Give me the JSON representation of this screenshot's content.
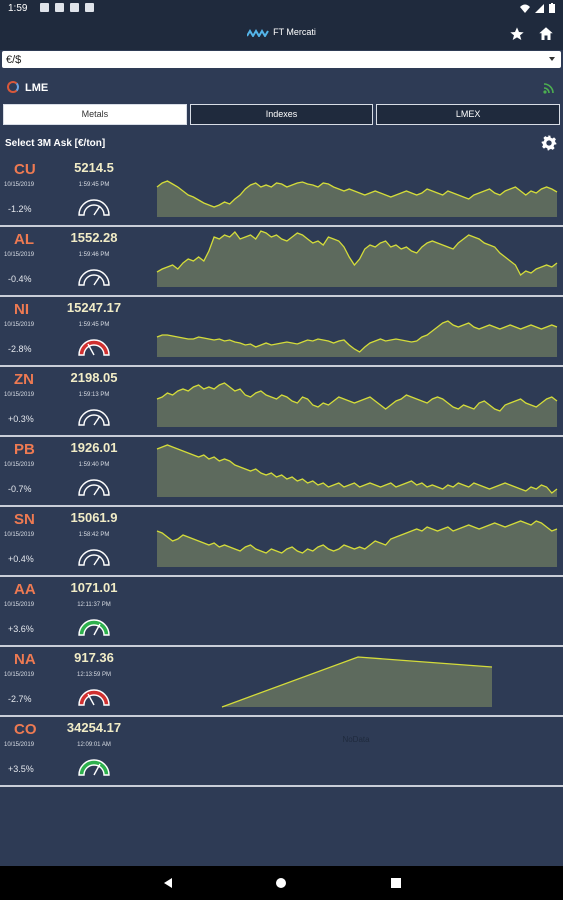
{
  "status_bar": {
    "time": "1:59"
  },
  "app_bar": {
    "title": "FT Mercati",
    "icons": [
      "logo-icon",
      "star-icon",
      "home-icon"
    ]
  },
  "currency": {
    "selected": "€/$"
  },
  "exchange": {
    "title": "LME"
  },
  "tabs": [
    {
      "label": "Metals",
      "active": true
    },
    {
      "label": "Indexes",
      "active": false
    },
    {
      "label": "LMEX",
      "active": false
    }
  ],
  "select_label": "Select 3M Ask [€/ton]",
  "colors": {
    "accent": "#ee7a52",
    "price": "#f1ecc6",
    "spark_line": "#d4dc3a",
    "spark_fill": "#5d6a5d",
    "background": "#2e3b55",
    "bar": "#1f2a3d",
    "gauge_red": "#d03030",
    "gauge_green": "#2db04d"
  },
  "rows": [
    {
      "symbol": "CU",
      "price": "5214.5",
      "date": "10/15/2019",
      "time": "1:59:45 PM",
      "change": "-1.2%",
      "gauge": "neutral",
      "series": [
        30,
        34,
        36,
        33,
        30,
        26,
        22,
        20,
        17,
        14,
        12,
        10,
        12,
        15,
        13,
        18,
        22,
        28,
        32,
        34,
        30,
        32,
        30,
        34,
        33,
        30,
        32,
        34,
        35,
        33,
        32,
        30,
        34,
        33,
        30,
        28,
        26,
        28,
        26,
        24,
        22,
        24,
        26,
        24,
        22,
        20,
        22,
        24,
        26,
        24,
        22,
        24,
        28,
        26,
        24,
        22,
        26,
        24,
        22,
        20,
        18,
        22,
        24,
        26,
        28,
        24,
        22,
        26,
        28,
        30,
        26,
        22,
        26,
        24,
        28,
        30,
        28,
        25
      ]
    },
    {
      "symbol": "AL",
      "price": "1552.28",
      "date": "10/15/2019",
      "time": "1:59:46 PM",
      "change": "-0.4%",
      "gauge": "neutral",
      "series": [
        15,
        18,
        20,
        22,
        18,
        24,
        28,
        26,
        30,
        26,
        36,
        50,
        48,
        52,
        50,
        55,
        48,
        50,
        52,
        48,
        56,
        54,
        50,
        52,
        48,
        46,
        50,
        54,
        52,
        48,
        44,
        46,
        42,
        50,
        48,
        46,
        40,
        30,
        22,
        28,
        38,
        42,
        40,
        44,
        46,
        40,
        42,
        38,
        40,
        36,
        34,
        40,
        44,
        46,
        44,
        42,
        40,
        38,
        44,
        48,
        52,
        50,
        48,
        44,
        42,
        40,
        34,
        30,
        26,
        22,
        12,
        16,
        14,
        18,
        20,
        22,
        20,
        24
      ]
    },
    {
      "symbol": "NI",
      "price": "15247.17",
      "date": "10/15/2019",
      "time": "1:59:45 PM",
      "change": "-2.8%",
      "gauge": "red",
      "series": [
        20,
        22,
        22,
        21,
        20,
        19,
        18,
        18,
        20,
        19,
        18,
        17,
        18,
        16,
        17,
        15,
        14,
        12,
        13,
        10,
        12,
        14,
        12,
        13,
        14,
        15,
        14,
        13,
        15,
        17,
        16,
        18,
        17,
        16,
        14,
        16,
        17,
        12,
        8,
        5,
        10,
        14,
        16,
        18,
        16,
        17,
        18,
        17,
        16,
        15,
        16,
        20,
        22,
        26,
        30,
        34,
        36,
        32,
        30,
        32,
        34,
        30,
        28,
        30,
        32,
        30,
        28,
        30,
        32,
        30,
        28,
        30,
        32,
        30,
        28,
        30,
        32,
        30
      ]
    },
    {
      "symbol": "ZN",
      "price": "2198.05",
      "date": "10/15/2019",
      "time": "1:59:13 PM",
      "change": "+0.3%",
      "gauge": "neutral",
      "series": [
        28,
        30,
        34,
        32,
        36,
        38,
        36,
        40,
        42,
        38,
        40,
        38,
        42,
        44,
        40,
        36,
        38,
        32,
        30,
        34,
        36,
        32,
        30,
        28,
        32,
        30,
        26,
        24,
        30,
        28,
        22,
        20,
        24,
        22,
        26,
        30,
        28,
        26,
        24,
        26,
        28,
        30,
        26,
        22,
        18,
        22,
        26,
        28,
        32,
        30,
        28,
        26,
        24,
        28,
        30,
        28,
        24,
        20,
        18,
        22,
        20,
        18,
        24,
        26,
        22,
        18,
        16,
        22,
        24,
        26,
        28,
        24,
        22,
        20,
        24,
        28,
        30,
        26
      ]
    },
    {
      "symbol": "PB",
      "price": "1926.01",
      "date": "10/15/2019",
      "time": "1:59:40 PM",
      "change": "-0.7%",
      "gauge": "neutral",
      "series": [
        48,
        50,
        52,
        50,
        48,
        46,
        44,
        42,
        40,
        42,
        38,
        40,
        36,
        38,
        36,
        32,
        30,
        28,
        26,
        28,
        24,
        22,
        24,
        20,
        22,
        18,
        20,
        16,
        18,
        14,
        16,
        12,
        14,
        10,
        12,
        14,
        10,
        12,
        14,
        10,
        12,
        14,
        12,
        10,
        12,
        14,
        10,
        12,
        14,
        16,
        12,
        14,
        10,
        12,
        10,
        8,
        12,
        10,
        14,
        12,
        10,
        14,
        12,
        10,
        8,
        10,
        12,
        14,
        12,
        10,
        8,
        6,
        10,
        8,
        12,
        10,
        4,
        8
      ]
    },
    {
      "symbol": "SN",
      "price": "15061.9",
      "date": "10/15/2019",
      "time": "1:58:42 PM",
      "change": "+0.4%",
      "gauge": "neutral",
      "series": [
        36,
        34,
        30,
        26,
        28,
        32,
        30,
        28,
        26,
        24,
        22,
        24,
        20,
        22,
        20,
        18,
        16,
        20,
        22,
        18,
        16,
        14,
        18,
        16,
        14,
        18,
        20,
        16,
        14,
        18,
        16,
        20,
        22,
        18,
        16,
        18,
        22,
        20,
        18,
        20,
        18,
        22,
        26,
        24,
        22,
        28,
        30,
        32,
        34,
        36,
        38,
        36,
        40,
        38,
        36,
        38,
        40,
        36,
        38,
        40,
        42,
        40,
        38,
        40,
        42,
        44,
        42,
        40,
        42,
        44,
        46,
        44,
        42,
        46,
        44,
        40,
        36,
        38
      ]
    },
    {
      "symbol": "AA",
      "price": "1071.01",
      "date": "10/15/2019",
      "time": "12:11:37 PM",
      "change": "+3.6%",
      "gauge": "green",
      "series": []
    },
    {
      "symbol": "NA",
      "price": "917.36",
      "date": "10/15/2019",
      "time": "12:13:59 PM",
      "change": "-2.7%",
      "gauge": "red",
      "series": [
        0,
        50,
        40
      ]
    },
    {
      "symbol": "CO",
      "price": "34254.17",
      "date": "10/15/2019",
      "time": "12:09:01 AM",
      "change": "+3.5%",
      "gauge": "green",
      "series": null,
      "no_data": "NoData"
    }
  ],
  "nav": [
    "back-icon",
    "home-nav-icon",
    "recents-icon"
  ]
}
